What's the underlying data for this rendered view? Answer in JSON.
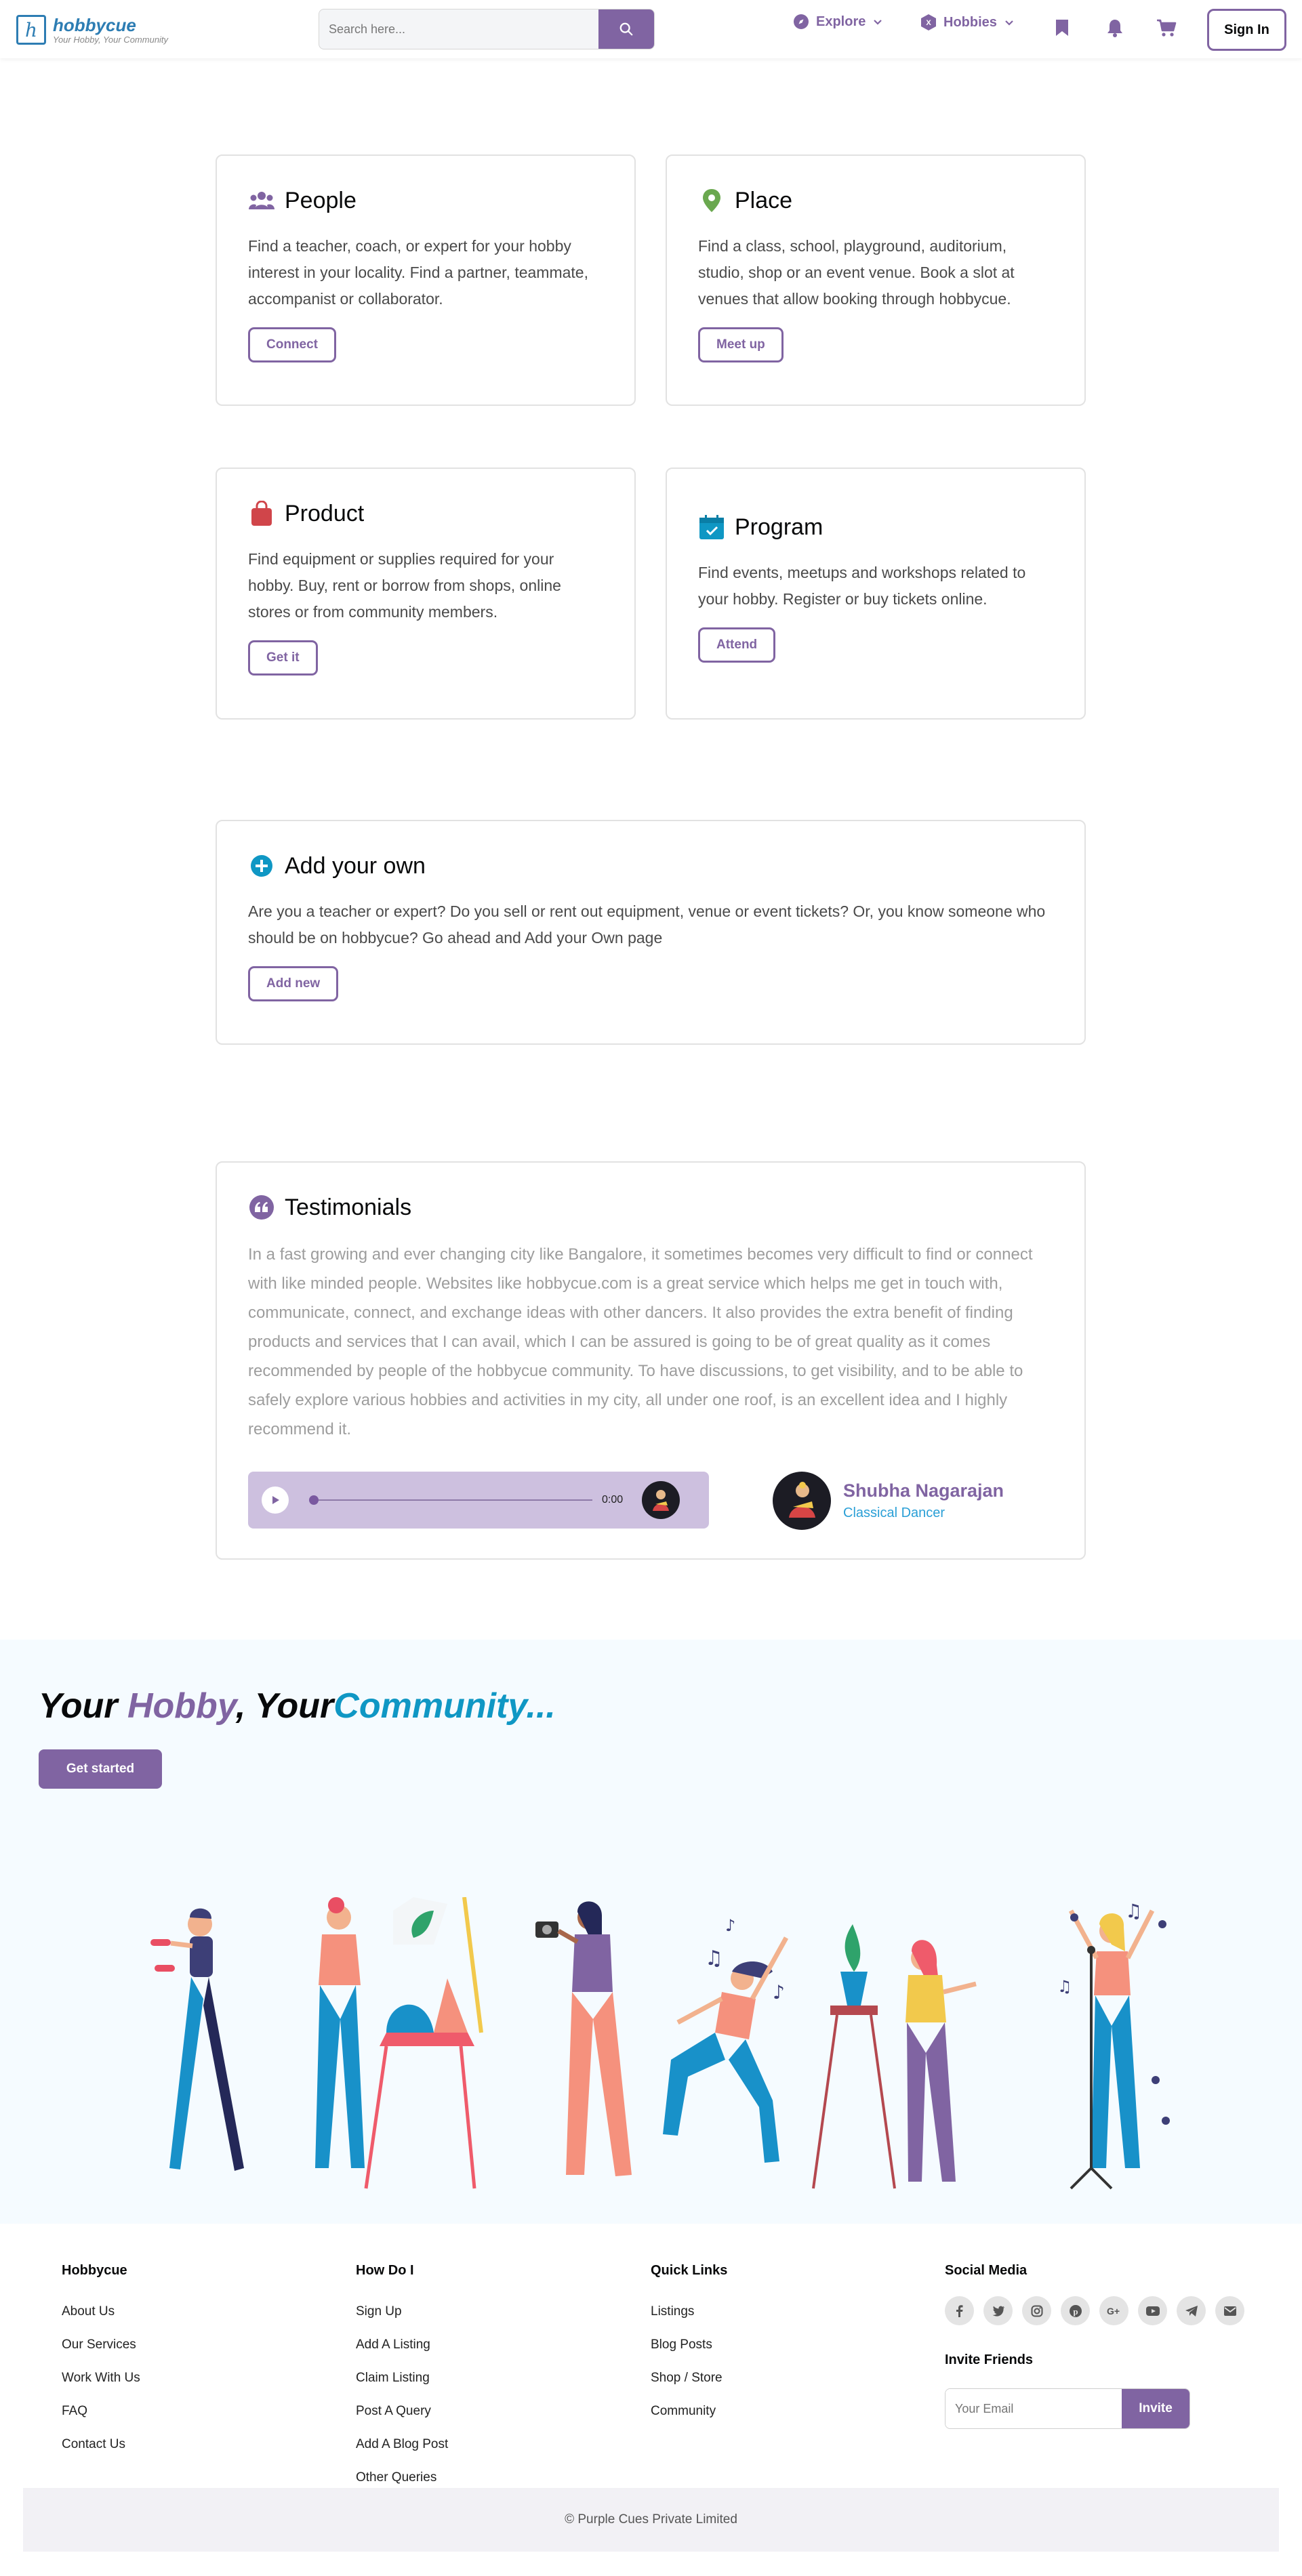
{
  "header": {
    "logo_name": "hobbycue",
    "logo_tagline": "Your Hobby, Your Community",
    "logo_letter": "h",
    "search_placeholder": "Search here...",
    "nav_explore": "Explore",
    "nav_hobbies": "Hobbies",
    "sign_in": "Sign In",
    "accent_color": "#8064a2"
  },
  "cards": {
    "people": {
      "title": "People",
      "text": "Find a teacher, coach, or expert for your hobby interest in your locality. Find a partner, teammate, accompanist or collaborator.",
      "button": "Connect"
    },
    "place": {
      "title": "Place",
      "text": "Find a class, school, playground, auditorium, studio, shop or an event venue. Book a slot at venues that allow booking through hobbycue.",
      "button": "Meet up"
    },
    "product": {
      "title": "Product",
      "text": "Find equipment or supplies required for your hobby. Buy, rent or borrow from shops, online stores or from community members.",
      "button": "Get it"
    },
    "program": {
      "title": "Program",
      "text": "Find events, meetups and workshops related to your hobby. Register or buy tickets online.",
      "button": "Attend"
    },
    "add_own": {
      "title": "Add your own",
      "text": "Are you a teacher or expert? Do you sell or rent out equipment, venue or event tickets? Or, you know someone who should be on hobbycue? Go ahead and Add your Own page",
      "button": "Add new"
    }
  },
  "testimonials": {
    "title": "Testimonials",
    "quote": "In a fast growing and ever changing city like Bangalore, it sometimes becomes very difficult to find or connect with like minded people. Websites like hobbycue.com is a great service which helps me get in touch with, communicate, connect, and exchange ideas with other dancers. It also provides the extra benefit of finding products and services that I can avail, which I can be assured is going to be of great quality as it comes recommended by people of the hobbycue community. To have discussions, to get visibility, and to be able to safely explore various hobbies and activities in my city, all under one roof, is an excellent idea and I highly recommend it.",
    "audio_time": "0:00",
    "author_name": "Shubha Nagarajan",
    "author_role": "Classical Dancer"
  },
  "hero": {
    "title_your1": "Your ",
    "title_hobby": "Hobby",
    "title_sep": ", Your",
    "title_community": "Community...",
    "button": "Get started"
  },
  "footer": {
    "col1": {
      "heading": "Hobbycue",
      "links": [
        "About Us",
        "Our Services",
        "Work With Us",
        "FAQ",
        "Contact Us"
      ]
    },
    "col2": {
      "heading": "How Do I",
      "links": [
        "Sign Up",
        "Add A Listing",
        "Claim Listing",
        "Post A Query",
        "Add A Blog Post",
        "Other Queries"
      ]
    },
    "col3": {
      "heading": "Quick Links",
      "links": [
        "Listings",
        "Blog Posts",
        "Shop / Store",
        "Community"
      ]
    },
    "social_heading": "Social Media",
    "social_icons": [
      "facebook-icon",
      "twitter-icon",
      "instagram-icon",
      "pinterest-icon",
      "google-plus-icon",
      "youtube-icon",
      "telegram-icon",
      "mail-icon"
    ],
    "invite_heading": "Invite Friends",
    "invite_placeholder": "Your Email",
    "invite_button": "Invite",
    "copyright": "©  Purple Cues Private Limited"
  }
}
